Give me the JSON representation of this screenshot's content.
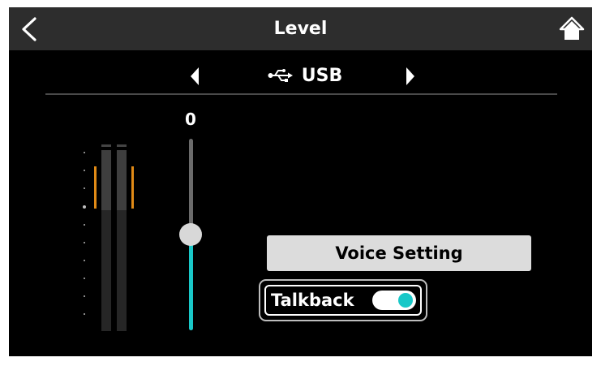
{
  "header": {
    "title": "Level",
    "back_icon": "chevron-left-icon",
    "home_icon": "home-icon"
  },
  "source": {
    "label": "USB",
    "icon": "usb-icon",
    "prev_icon": "triangle-left-icon",
    "next_icon": "triangle-right-icon"
  },
  "fader": {
    "level_value": "0",
    "position_fraction": 0.5
  },
  "buttons": {
    "voice_setting": "Voice Setting"
  },
  "talkback": {
    "label": "Talkback",
    "enabled": true
  },
  "colors": {
    "accent": "#19c8c8",
    "peak": "#e08a16",
    "titlebar": "#2d2d2d",
    "background": "#000000"
  }
}
